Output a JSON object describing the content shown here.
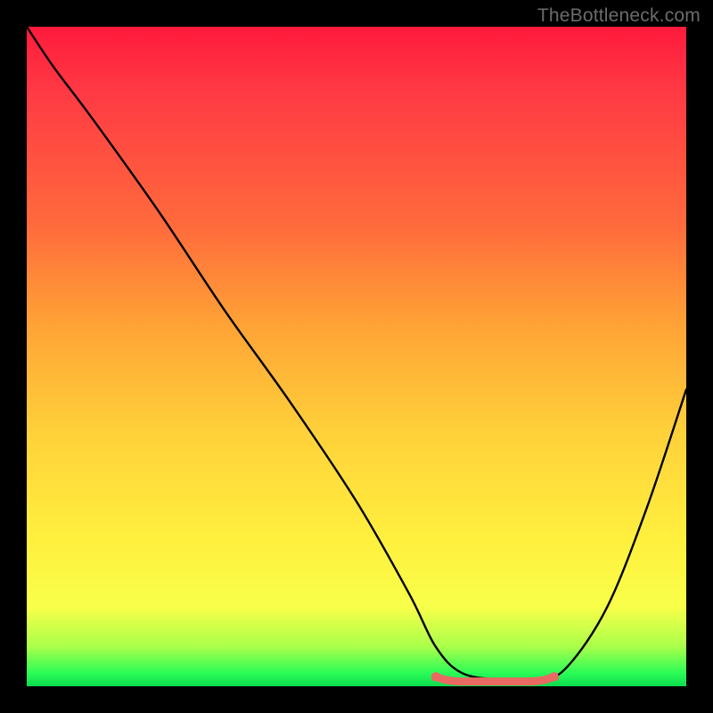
{
  "watermark": "TheBottleneck.com",
  "colors": {
    "frame": "#000000",
    "curve": "#000000",
    "marker": "#e86a63",
    "gradient_stops": [
      "#ff1a3c",
      "#ff6a3c",
      "#ffd23a",
      "#fff03e",
      "#2bfc57"
    ]
  },
  "chart_data": {
    "type": "line",
    "title": "",
    "xlabel": "",
    "ylabel": "",
    "xlim": [
      0,
      100
    ],
    "ylim": [
      0,
      100
    ],
    "series": [
      {
        "name": "bottleneck-curve",
        "x": [
          0,
          4,
          10,
          20,
          30,
          40,
          50,
          58,
          62,
          66,
          72,
          78,
          82,
          88,
          94,
          100
        ],
        "values": [
          100,
          94,
          86,
          72,
          57,
          43,
          28,
          14,
          6,
          2,
          1,
          1,
          3,
          12,
          27,
          45
        ]
      }
    ],
    "highlight_range": {
      "x_start": 62,
      "x_end": 80,
      "y": 1
    }
  }
}
